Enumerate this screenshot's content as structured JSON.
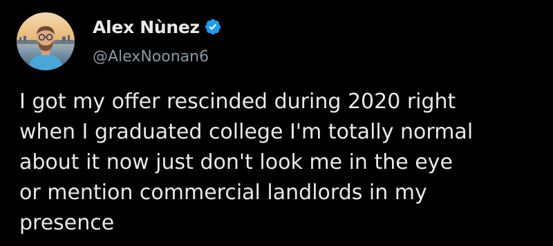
{
  "author": {
    "display_name": "Alex Nùnez",
    "handle": "@AlexNoonan6",
    "verified_icon": "verified-badge-icon",
    "verified_color": "#1d9bf0"
  },
  "tweet": {
    "lines": [
      "I got my offer rescinded during 2020 right",
      "when I graduated college I'm totally normal",
      "about it now just don't look me in the eye",
      "or mention commercial landlords in my",
      "presence"
    ]
  },
  "colors": {
    "background": "#000000",
    "text": "#e7e9ea",
    "secondary_text": "#8b98a5"
  }
}
